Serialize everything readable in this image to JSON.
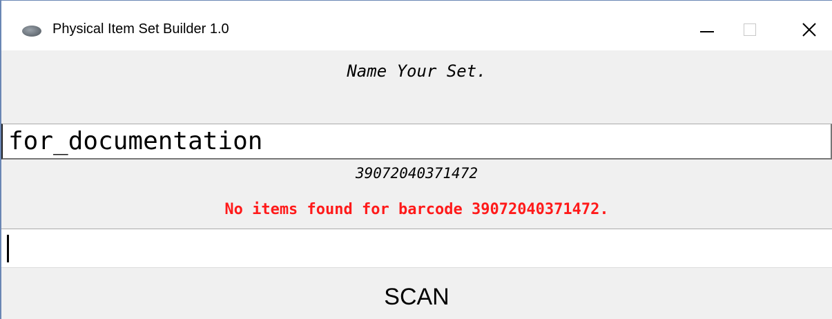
{
  "window": {
    "title": "Physical Item Set Builder 1.0",
    "app_icon": "app-pebble-icon",
    "controls": {
      "minimize": "minimize-icon",
      "maximize": "maximize-icon",
      "close_glyph": "✕"
    }
  },
  "form": {
    "prompt": "Name Your Set.",
    "set_name_value": "for_documentation",
    "last_barcode": "39072040371472",
    "message": "No items found for barcode 39072040371472.",
    "message_color": "#ff1a1a",
    "scan_input_value": "",
    "scan_button_label": "SCAN"
  }
}
